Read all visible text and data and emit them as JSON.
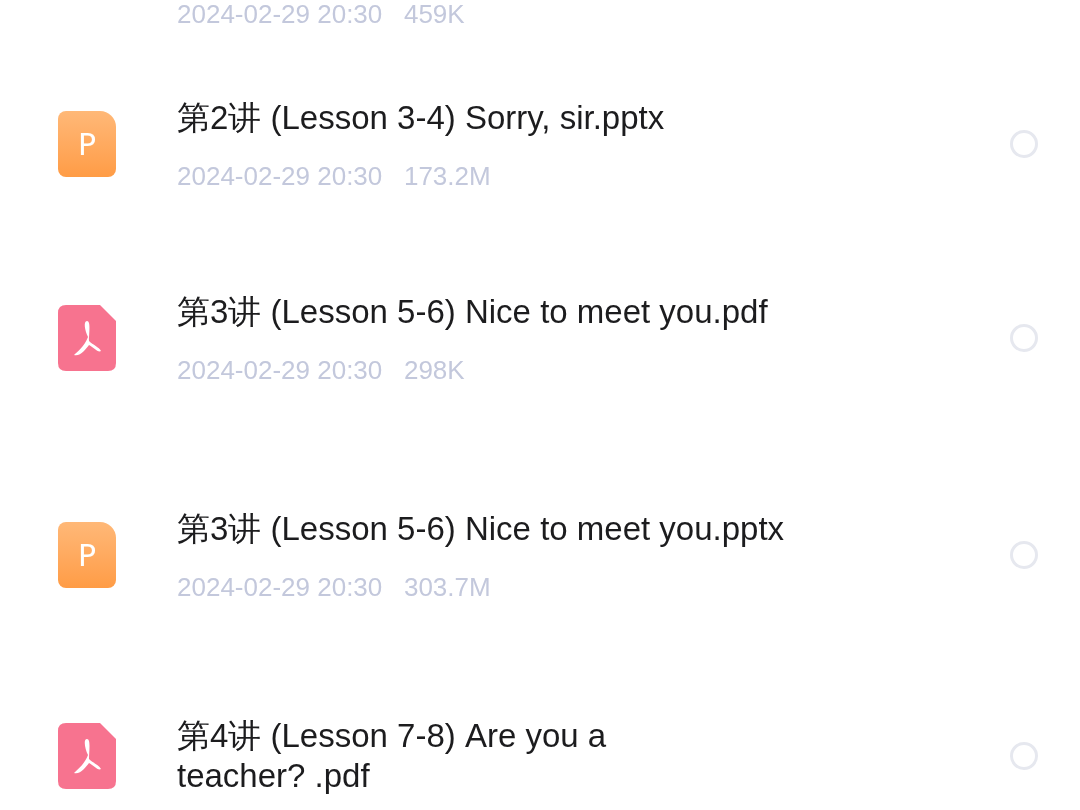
{
  "top_meta": [
    "2024-02-29 20:30",
    "459K"
  ],
  "files": [
    {
      "kind": "pptx",
      "icon_letter": "P",
      "title_lines": [
        "第2讲 (Lesson 3-4) Sorry, sir.pptx"
      ],
      "meta": [
        "2024-02-29 20:30",
        "173.2M"
      ],
      "selected": false
    },
    {
      "kind": "pdf",
      "title_lines": [
        "第3讲 (Lesson 5-6) Nice to meet you.pdf"
      ],
      "meta": [
        "2024-02-29 20:30",
        "298K"
      ],
      "selected": false
    },
    {
      "kind": "pptx",
      "icon_letter": "P",
      "title_lines": [
        "第3讲 (Lesson 5-6) Nice to meet you.pptx"
      ],
      "meta": [
        "2024-02-29 20:30",
        "303.7M"
      ],
      "selected": false
    },
    {
      "kind": "pdf",
      "title_lines": [
        "第4讲 (Lesson 7-8) Are you a",
        "teacher?  .pdf"
      ],
      "selected": false
    }
  ]
}
